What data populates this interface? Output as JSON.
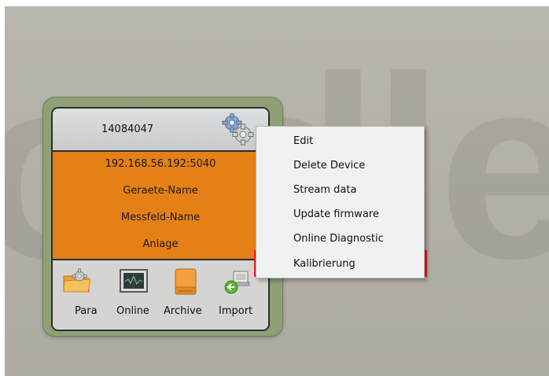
{
  "background": {
    "watermark_text": "ordle"
  },
  "device": {
    "serial": "14084047",
    "address": "192.168.56.192:5040",
    "device_name": "Geraete-Name",
    "field_name": "Messfeld-Name",
    "plant": "Anlage"
  },
  "actions": [
    {
      "label": "Para",
      "icon": "folder-gear-icon"
    },
    {
      "label": "Online",
      "icon": "monitor-icon"
    },
    {
      "label": "Archive",
      "icon": "drive-icon"
    },
    {
      "label": "Import",
      "icon": "import-icon"
    }
  ],
  "context_menu": {
    "items": [
      "Edit",
      "Delete Device",
      "Stream data",
      "Update firmware",
      "Online Diagnostic",
      "Kalibrierung"
    ],
    "highlighted_item": "Kalibrierung",
    "highlight_color": "#ee1b23"
  },
  "colors": {
    "orange_panel": "#e48016",
    "tile_frame": "#8fa077"
  }
}
